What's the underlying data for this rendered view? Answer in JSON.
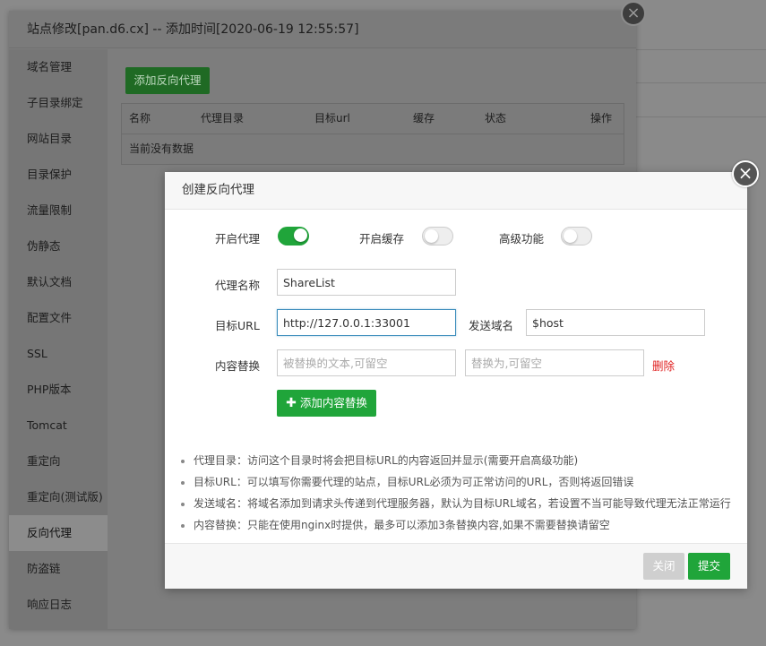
{
  "site_dialog": {
    "title": "站点修改[pan.d6.cx] -- 添加时间[2020-06-19 12:55:57]",
    "close_glyph": "×",
    "nav": [
      {
        "label": "域名管理"
      },
      {
        "label": "子目录绑定"
      },
      {
        "label": "网站目录"
      },
      {
        "label": "目录保护"
      },
      {
        "label": "流量限制"
      },
      {
        "label": "伪静态"
      },
      {
        "label": "默认文档"
      },
      {
        "label": "配置文件"
      },
      {
        "label": "SSL"
      },
      {
        "label": "PHP版本"
      },
      {
        "label": "Tomcat"
      },
      {
        "label": "重定向"
      },
      {
        "label": "重定向(测试版)"
      },
      {
        "label": "反向代理",
        "active": true
      },
      {
        "label": "防盗链"
      },
      {
        "label": "响应日志"
      }
    ],
    "add_button": "添加反向代理",
    "table": {
      "columns": [
        "名称",
        "代理目录",
        "目标url",
        "缓存",
        "状态",
        "操作"
      ],
      "empty_text": "当前没有数据"
    }
  },
  "proxy_dialog": {
    "title": "创建反向代理",
    "close_glyph": "×",
    "toggles": {
      "proxy": {
        "label": "开启代理",
        "on": true
      },
      "cache": {
        "label": "开启缓存",
        "on": false
      },
      "advanced": {
        "label": "高级功能",
        "on": false
      }
    },
    "name_label": "代理名称",
    "name_value": "ShareList",
    "url_label": "目标URL",
    "url_value": "http://127.0.0.1:33001",
    "send_domain_label": "发送域名",
    "send_domain_value": "$host",
    "replace_label": "内容替换",
    "replace_from_placeholder": "被替换的文本,可留空",
    "replace_to_placeholder": "替换为,可留空",
    "delete_label": "删除",
    "add_replace_label": "添加内容替换",
    "tips": [
      "代理目录：访问这个目录时将会把目标URL的内容返回并显示(需要开启高级功能)",
      "目标URL：可以填写你需要代理的站点，目标URL必须为可正常访问的URL，否则将返回错误",
      "发送域名：将域名添加到请求头传递到代理服务器，默认为目标URL域名，若设置不当可能导致代理无法正常运行",
      "内容替换：只能在使用nginx时提供，最多可以添加3条替换内容,如果不需要替换请留空"
    ],
    "close_button": "关闭",
    "submit_button": "提交"
  },
  "colors": {
    "accent_green": "#20a53a",
    "danger_red": "#e02020",
    "overlay_gray": "#7f7f7f"
  }
}
